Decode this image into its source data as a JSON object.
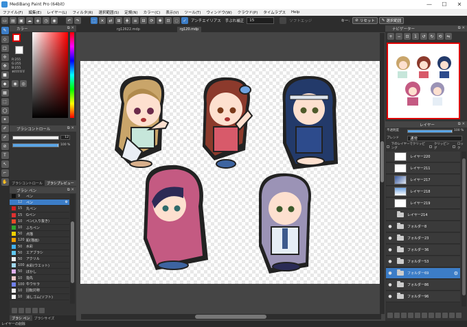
{
  "window": {
    "title": "MediBang Paint Pro (64bit)",
    "controls": [
      "—",
      "☐",
      "✕"
    ]
  },
  "menu": [
    "ファイル(F)",
    "編集(E)",
    "レイヤー(L)",
    "フィルタ(R)",
    "選択範囲(S)",
    "定規(N)",
    "カラー(C)",
    "表示(V)",
    "ツール(T)",
    "ウィンドウ(W)",
    "クラウド(P)",
    "タイムラプス",
    "Help"
  ],
  "toolbar": {
    "antialias": "アンチエイリアス",
    "correction_label": "手ぶれ補正",
    "correction_value": "15",
    "softedge": "ソフトエッジ",
    "key_label": "キー:",
    "reset": "リセット",
    "fill": "選択範囲"
  },
  "color_panel": {
    "title": "カラー",
    "rgb": [
      "R:255",
      "G:255",
      "B:255"
    ],
    "hex": "#FFFFFF"
  },
  "brush_control": {
    "title": "ブラシコントロール",
    "size_value": "12",
    "opacity_value": "100 %"
  },
  "brush_tabs": [
    "ブラシコントロール",
    "ブラシプレビュー"
  ],
  "brush_panel": {
    "title": "ブラシ ペン",
    "items": [
      {
        "size": "9",
        "name": "ペン",
        "color": "#111111"
      },
      {
        "size": "12",
        "name": "ペン",
        "color": "#3c7dc7",
        "selected": true
      },
      {
        "size": "15",
        "name": "丸ペン",
        "color": "#d32020"
      },
      {
        "size": "15",
        "name": "Gペン",
        "color": "#e03030"
      },
      {
        "size": "10",
        "name": "ペン(入り抜き)",
        "color": "#e84a2a"
      },
      {
        "size": "10",
        "name": "ふちペン",
        "color": "#2fa52f"
      },
      {
        "size": "50",
        "name": "点描",
        "color": "#f0d000"
      },
      {
        "size": "120",
        "name": "鉛(描画)",
        "color": "#f0a000"
      },
      {
        "size": "50",
        "name": "水彩",
        "color": "#40b0f0"
      },
      {
        "size": "50",
        "name": "エアブラシ",
        "color": "#60c8f0"
      },
      {
        "size": "50",
        "name": "アクリル",
        "color": "#f0f0f0"
      },
      {
        "size": "100",
        "name": "水彩(ウエット)",
        "color": "#a0d8f0"
      },
      {
        "size": "50",
        "name": "ぼかし",
        "color": "#e0b0f0"
      },
      {
        "size": "10",
        "name": "指先",
        "color": "#f0c8c8"
      },
      {
        "size": "100",
        "name": "牛ウセラ",
        "color": "#7080f0"
      },
      {
        "size": "10",
        "name": "回転対称",
        "color": "#f0f0f0"
      },
      {
        "size": "10",
        "name": "消しゴム(ソフト)",
        "color": "#ffffff"
      }
    ]
  },
  "doc_tabs": [
    "rg12622.mdp",
    "rg120.mdp"
  ],
  "navigator": {
    "title": "ナビゲーター"
  },
  "layer_panel": {
    "title": "レイヤー",
    "opacity_label": "不透明度",
    "opacity_value": "100 %",
    "blend_label": "ブレンド",
    "blend_value": "通常",
    "options": [
      "下のレイヤーでクリッピング",
      "クリッピング",
      "ロック"
    ],
    "layers": [
      {
        "name": "レイヤー220",
        "type": "layer"
      },
      {
        "name": "レイヤー211",
        "type": "layer"
      },
      {
        "name": "レイヤー217",
        "type": "layer"
      },
      {
        "name": "レイヤー218",
        "type": "layer"
      },
      {
        "name": "レイヤー219",
        "type": "layer"
      },
      {
        "name": "レイヤー214",
        "type": "folder"
      },
      {
        "name": "フォルダー8",
        "type": "folder"
      },
      {
        "name": "フォルダー23",
        "type": "folder"
      },
      {
        "name": "フォルダー36",
        "type": "folder"
      },
      {
        "name": "フォルダー53",
        "type": "folder"
      },
      {
        "name": "フォルダー69",
        "type": "folder",
        "selected": true
      },
      {
        "name": "フォルダー86",
        "type": "folder"
      },
      {
        "name": "フォルダー96",
        "type": "folder"
      }
    ]
  },
  "status": {
    "text": "レイヤーの削除"
  },
  "bottom_tabs": [
    "ブラシ ペン",
    "ブラシサイズ"
  ]
}
